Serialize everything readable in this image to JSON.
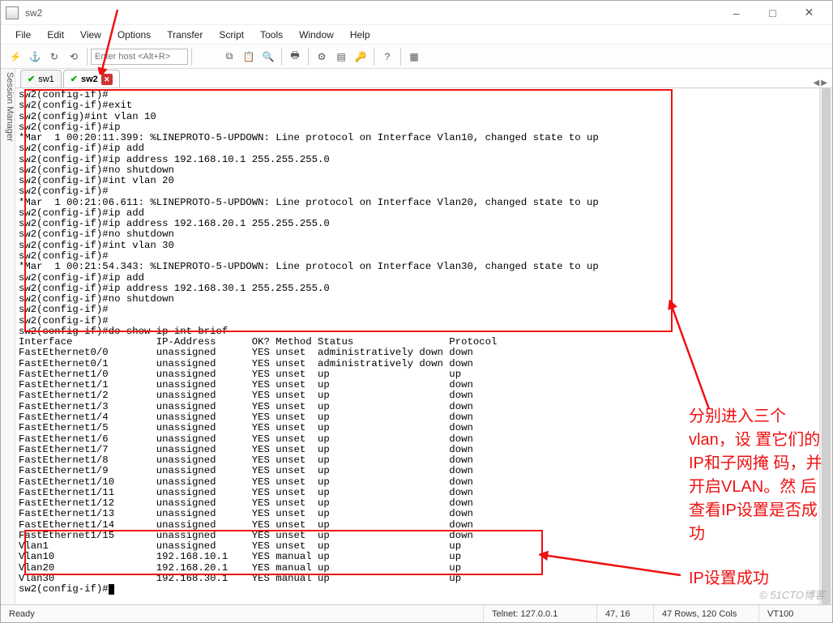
{
  "window": {
    "title": "sw2"
  },
  "menubar": {
    "items": [
      "File",
      "Edit",
      "View",
      "Options",
      "Transfer",
      "Script",
      "Tools",
      "Window",
      "Help"
    ]
  },
  "toolbar": {
    "host_placeholder": "Enter host <Alt+R>"
  },
  "session_sidebar_label": "Session Manager",
  "tabs": [
    {
      "label": "sw1",
      "active": false
    },
    {
      "label": "sw2",
      "active": true
    }
  ],
  "terminal_lines": [
    "sw2(config-if)#",
    "sw2(config-if)#exit",
    "sw2(config)#int vlan 10",
    "sw2(config-if)#ip",
    "*Mar  1 00:20:11.399: %LINEPROTO-5-UPDOWN: Line protocol on Interface Vlan10, changed state to up",
    "sw2(config-if)#ip add",
    "sw2(config-if)#ip address 192.168.10.1 255.255.255.0",
    "sw2(config-if)#no shutdown",
    "sw2(config-if)#int vlan 20",
    "sw2(config-if)#",
    "*Mar  1 00:21:06.611: %LINEPROTO-5-UPDOWN: Line protocol on Interface Vlan20, changed state to up",
    "sw2(config-if)#ip add",
    "sw2(config-if)#ip address 192.168.20.1 255.255.255.0",
    "sw2(config-if)#no shutdown",
    "sw2(config-if)#int vlan 30",
    "sw2(config-if)#",
    "*Mar  1 00:21:54.343: %LINEPROTO-5-UPDOWN: Line protocol on Interface Vlan30, changed state to up",
    "sw2(config-if)#ip add",
    "sw2(config-if)#ip address 192.168.30.1 255.255.255.0",
    "sw2(config-if)#no shutdown",
    "sw2(config-if)#",
    "sw2(config-if)#",
    "sw2(config-if)#do show ip int brief",
    "Interface              IP-Address      OK? Method Status                Protocol",
    "FastEthernet0/0        unassigned      YES unset  administratively down down",
    "FastEthernet0/1        unassigned      YES unset  administratively down down",
    "FastEthernet1/0        unassigned      YES unset  up                    up",
    "FastEthernet1/1        unassigned      YES unset  up                    down",
    "FastEthernet1/2        unassigned      YES unset  up                    down",
    "FastEthernet1/3        unassigned      YES unset  up                    down",
    "FastEthernet1/4        unassigned      YES unset  up                    down",
    "FastEthernet1/5        unassigned      YES unset  up                    down",
    "FastEthernet1/6        unassigned      YES unset  up                    down",
    "FastEthernet1/7        unassigned      YES unset  up                    down",
    "FastEthernet1/8        unassigned      YES unset  up                    down",
    "FastEthernet1/9        unassigned      YES unset  up                    down",
    "FastEthernet1/10       unassigned      YES unset  up                    down",
    "FastEthernet1/11       unassigned      YES unset  up                    down",
    "FastEthernet1/12       unassigned      YES unset  up                    down",
    "FastEthernet1/13       unassigned      YES unset  up                    down",
    "FastEthernet1/14       unassigned      YES unset  up                    down",
    "FastEthernet1/15       unassigned      YES unset  up                    down",
    "Vlan1                  unassigned      YES unset  up                    up",
    "Vlan10                 192.168.10.1    YES manual up                    up",
    "Vlan20                 192.168.20.1    YES manual up                    up",
    "Vlan30                 192.168.30.1    YES manual up                    up",
    "sw2(config-if)#"
  ],
  "statusbar": {
    "ready": "Ready",
    "conn": "Telnet: 127.0.0.1",
    "pos": "47,  16",
    "size": "47 Rows, 120 Cols",
    "term": "VT100"
  },
  "annotations": {
    "text1": "分别进入三个vlan，设\n置它们的IP和子网掩\n码，并开启VLAN。然\n后查看IP设置是否成功",
    "text2": "IP设置成功"
  },
  "watermark": "© 51CTO博客"
}
